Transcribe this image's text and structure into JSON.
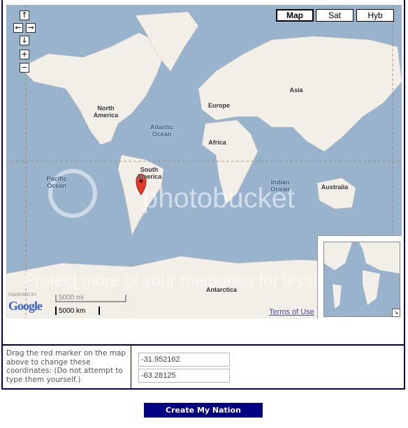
{
  "map": {
    "type_buttons": [
      {
        "label": "Map",
        "active": true
      },
      {
        "label": "Sat",
        "active": false
      },
      {
        "label": "Hyb",
        "active": false
      }
    ],
    "nav_controls": {
      "up": "↑",
      "left": "←",
      "right": "→",
      "down": "↓",
      "zoom_in": "+",
      "zoom_out": "−"
    },
    "labels": {
      "north_america": "North America",
      "atlantic": "Atlantic Ocean",
      "europe": "Europe",
      "asia": "Asia",
      "africa": "Africa",
      "south_america": "South America",
      "pacific": "Pacific Ocean",
      "indian": "Indian Ocean",
      "australia": "Australia",
      "antarctica": "Antarctica"
    },
    "scale": {
      "miles": "5000 mi",
      "km": "5000 km"
    },
    "powered_by": "POWERED BY",
    "logo": "Google",
    "terms": "Terms of Use",
    "overview_toggle": "↘",
    "watermark": {
      "brand": "photobucket",
      "tagline": "Protect more of your memories for less!"
    },
    "colors": {
      "water": "#99b3cc",
      "land": "#f2efe9",
      "marker": "#e33a2c"
    }
  },
  "form": {
    "instructions": "Drag the red marker on the map above to change these coordinates: (Do not attempt to type them yourself.)",
    "latitude": "-31.952162",
    "longitude": "-63.28125"
  },
  "submit_label": "Create My Nation"
}
